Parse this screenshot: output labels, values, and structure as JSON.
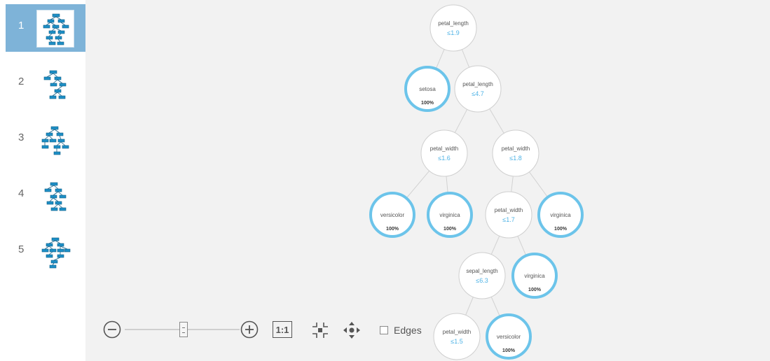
{
  "sidebar": {
    "items": [
      {
        "number": "1",
        "selected": true
      },
      {
        "number": "2",
        "selected": false
      },
      {
        "number": "3",
        "selected": false
      },
      {
        "number": "4",
        "selected": false
      },
      {
        "number": "5",
        "selected": false
      }
    ]
  },
  "toolbar": {
    "zoom_level": 0.6,
    "actual_size_label": "1:1",
    "edges_label": "Edges",
    "edges_checked": false
  },
  "colors": {
    "leaf_ring": "#6cc4ea",
    "condition_text": "#4fb3e6",
    "selected_item": "#7eb3d8",
    "canvas_background": "#f2f2f2"
  },
  "tree": {
    "nodes": [
      {
        "id": "root",
        "kind": "split",
        "title": "petal_length",
        "condition": "≤1.9"
      },
      {
        "id": "leaf-setosa",
        "kind": "leaf",
        "title": "setosa",
        "percent": "100%"
      },
      {
        "id": "n2",
        "kind": "split",
        "title": "petal_length",
        "condition": "≤4.7"
      },
      {
        "id": "n3",
        "kind": "split",
        "title": "petal_width",
        "condition": "≤1.6"
      },
      {
        "id": "n4",
        "kind": "split",
        "title": "petal_width",
        "condition": "≤1.8"
      },
      {
        "id": "leaf-versicolor-1",
        "kind": "leaf",
        "title": "versicolor",
        "percent": "100%"
      },
      {
        "id": "leaf-virginica-1",
        "kind": "leaf",
        "title": "virginica",
        "percent": "100%"
      },
      {
        "id": "n5",
        "kind": "split",
        "title": "petal_width",
        "condition": "≤1.7"
      },
      {
        "id": "leaf-virginica-2",
        "kind": "leaf",
        "title": "virginica",
        "percent": "100%"
      },
      {
        "id": "n6",
        "kind": "split",
        "title": "sepal_length",
        "condition": "≤6.3"
      },
      {
        "id": "leaf-virginica-3",
        "kind": "leaf",
        "title": "virginica",
        "percent": "100%"
      },
      {
        "id": "n7",
        "kind": "split",
        "title": "petal_width",
        "condition": "≤1.5"
      },
      {
        "id": "leaf-versicolor-2",
        "kind": "leaf",
        "title": "versicolor",
        "percent": "100%"
      }
    ],
    "edges": [
      [
        "root",
        "leaf-setosa"
      ],
      [
        "root",
        "n2"
      ],
      [
        "n2",
        "n3"
      ],
      [
        "n2",
        "n4"
      ],
      [
        "n3",
        "leaf-versicolor-1"
      ],
      [
        "n3",
        "leaf-virginica-1"
      ],
      [
        "n4",
        "n5"
      ],
      [
        "n4",
        "leaf-virginica-2"
      ],
      [
        "n5",
        "n6"
      ],
      [
        "n5",
        "leaf-virginica-3"
      ],
      [
        "n6",
        "n7"
      ],
      [
        "n6",
        "leaf-versicolor-2"
      ]
    ]
  }
}
